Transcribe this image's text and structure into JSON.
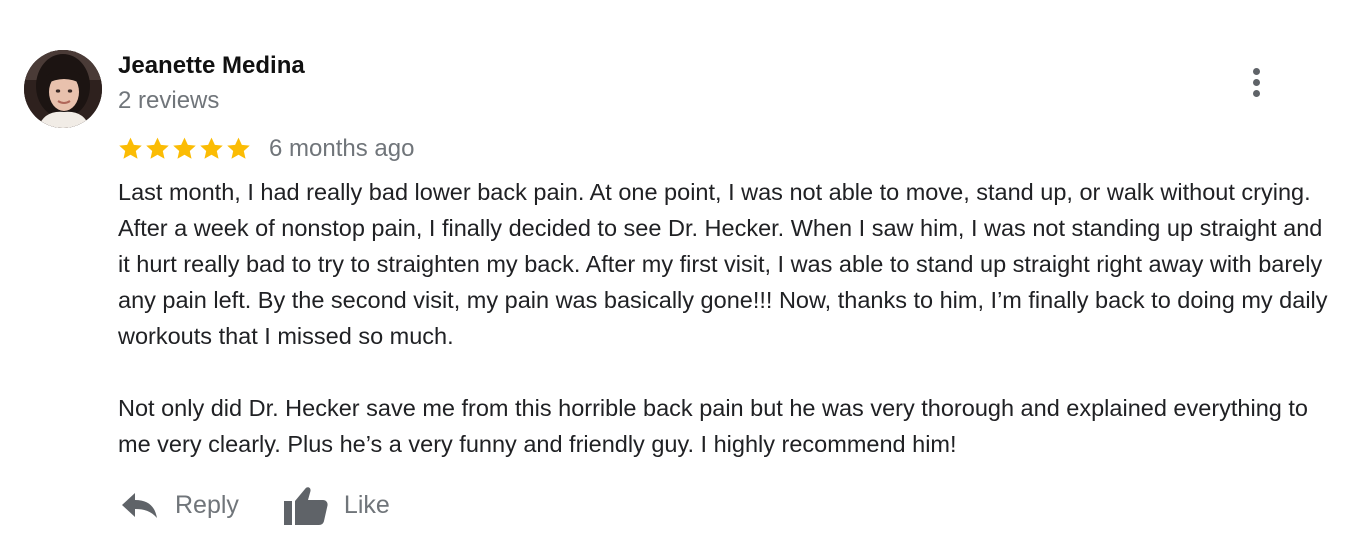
{
  "review": {
    "author_name": "Jeanette Medina",
    "review_count": "2 reviews",
    "rating": 5,
    "rating_max": 5,
    "time_ago": "6 months ago",
    "paragraphs": [
      "Last month, I had really bad lower back pain. At one point, I was not able to move, stand up, or walk without crying. After a week of nonstop pain, I finally decided to see Dr. Hecker. When I saw him, I was not standing up straight and it hurt really bad to try to straighten my back. After my first visit, I was able to stand up straight right away with barely any pain left. By the second visit, my pain was basically gone!!! Now, thanks to him, I’m finally back to doing my daily workouts that I missed so much.",
      "Not only did Dr. Hecker save me from this horrible back pain but he was very thorough and explained everything to me very clearly. Plus he’s a very funny and friendly guy. I highly recommend him!"
    ]
  },
  "actions": {
    "reply_label": "Reply",
    "like_label": "Like"
  },
  "icons": {
    "avatar": "user-avatar-photo",
    "more": "more-vert-icon",
    "star": "star-icon",
    "reply": "reply-arrow-icon",
    "like": "thumbs-up-icon"
  },
  "colors": {
    "star": "#fbbc04",
    "secondary_text": "#70757a",
    "icon": "#5f6368",
    "primary_text": "#202124"
  }
}
